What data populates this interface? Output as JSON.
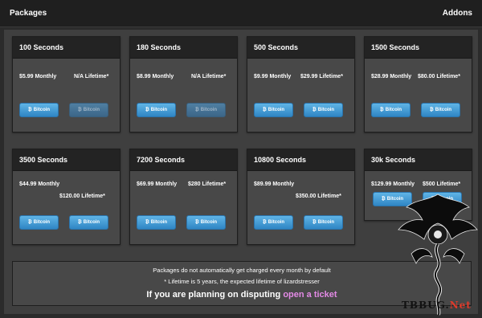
{
  "header": {
    "title": "Packages",
    "addons_link": "Addons"
  },
  "button_label": "Bitcoin",
  "packages": [
    {
      "name": "100 Seconds",
      "monthly": "$5.99 Monthly",
      "lifetime": "N/A Lifetime*"
    },
    {
      "name": "180 Seconds",
      "monthly": "$8.99 Monthly",
      "lifetime": "N/A Lifetime*"
    },
    {
      "name": "500 Seconds",
      "monthly": "$9.99 Monthly",
      "lifetime": "$29.99 Lifetime*"
    },
    {
      "name": "1500 Seconds",
      "monthly": "$28.99 Monthly",
      "lifetime": "$80.00 Lifetime*"
    },
    {
      "name": "3500 Seconds",
      "monthly": "$44.99 Monthly",
      "lifetime": "$120.00 Lifetime*"
    },
    {
      "name": "7200 Seconds",
      "monthly": "$69.99 Monthly",
      "lifetime": "$280 Lifetime*"
    },
    {
      "name": "10800 Seconds",
      "monthly": "$89.99 Monthly",
      "lifetime": "$350.00 Lifetime*"
    },
    {
      "name": "30k Seconds",
      "monthly": "$129.99 Monthly",
      "lifetime": "$500 Lifetime*"
    }
  ],
  "info": {
    "line1": "Packages do not automatically get charged every month by default",
    "line2": "* Lifetime is 5 years, the expected lifetime of lizardstresser",
    "dispute_text": "If you are planning on disputing",
    "dispute_link": "open a ticket"
  },
  "watermark": {
    "text_main": "TBBUG.",
    "text_net": "Net"
  },
  "colors": {
    "button": "#3a95d2",
    "link": "#e38ae6",
    "watermark_net": "#e03a2a"
  }
}
